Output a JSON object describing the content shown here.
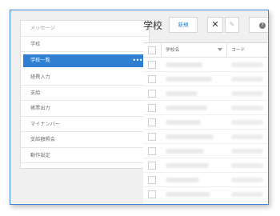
{
  "sidebar": {
    "items": [
      {
        "label": "メッセージ"
      },
      {
        "label": "学校"
      },
      {
        "label": "学校一覧",
        "more": "•••"
      },
      {
        "label": "経費入力"
      },
      {
        "label": "支給"
      },
      {
        "label": "帳票出力"
      },
      {
        "label": "マイナンバー"
      },
      {
        "label": "支給額照会"
      },
      {
        "label": "動作設定"
      }
    ]
  },
  "main": {
    "title": "学校",
    "new_label": "新規",
    "close_symbol": "✕",
    "edit_symbol": "✎",
    "help_symbol": "?"
  },
  "table": {
    "columns": [
      "学校名",
      "コード"
    ]
  },
  "colors": {
    "accent": "#2f80d2",
    "frame_border": "#3f86d4"
  }
}
